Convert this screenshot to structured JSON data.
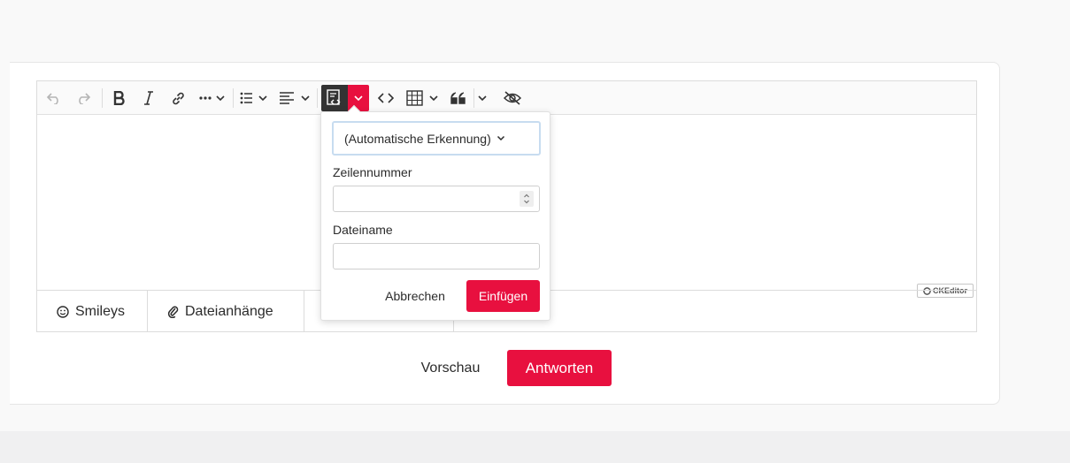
{
  "toolbar": {
    "items": [
      {
        "icon": "undo-icon"
      },
      {
        "icon": "redo-icon"
      },
      {
        "icon": "bold-icon"
      },
      {
        "icon": "italic-icon"
      },
      {
        "icon": "link-icon"
      },
      {
        "icon": "more-icon"
      },
      {
        "icon": "bulleted-list-icon"
      },
      {
        "icon": "align-icon"
      },
      {
        "icon": "code-block-icon"
      },
      {
        "icon": "code-icon"
      },
      {
        "icon": "table-icon"
      },
      {
        "icon": "blockquote-icon"
      },
      {
        "icon": "hide-icon"
      }
    ],
    "active_color": "#333333",
    "accent_color": "#e8103f"
  },
  "ckeditor_badge": "CKEditor",
  "attachments": {
    "tabs": [
      {
        "label": "Smileys",
        "icon": "smiley-icon"
      },
      {
        "label": "Dateianhänge",
        "icon": "paperclip-icon"
      },
      {
        "label": ""
      }
    ]
  },
  "code_popup": {
    "language_select": "(Automatische Erkennung)",
    "line_number_label": "Zeilennummer",
    "line_number_value": "",
    "filename_label": "Dateiname",
    "filename_value": "",
    "cancel_label": "Abbrechen",
    "insert_label": "Einfügen"
  },
  "actions": {
    "preview_label": "Vorschau",
    "reply_label": "Antworten"
  }
}
